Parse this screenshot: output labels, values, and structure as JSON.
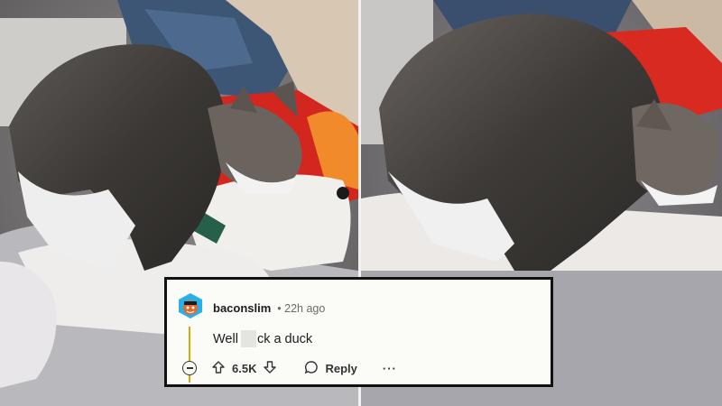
{
  "comment": {
    "username": "baconslim",
    "timestamp": "22h ago",
    "text_before": "Well",
    "text_after": "ck a duck",
    "vote_count": "6.5K",
    "reply_label": "Reply",
    "more_label": "···"
  },
  "icons": {
    "avatar": "snoo-avatar-icon",
    "collapse": "collapse-minus-icon",
    "upvote": "upvote-arrow-icon",
    "downvote": "downvote-arrow-icon",
    "reply": "speech-bubble-icon",
    "more": "ellipsis-icon"
  },
  "colors": {
    "card_background": "#fbfbf7",
    "card_border": "#111111",
    "thread_line": "#e3a300",
    "username": "#1c1c1c",
    "meta": "#6b6b6b"
  }
}
